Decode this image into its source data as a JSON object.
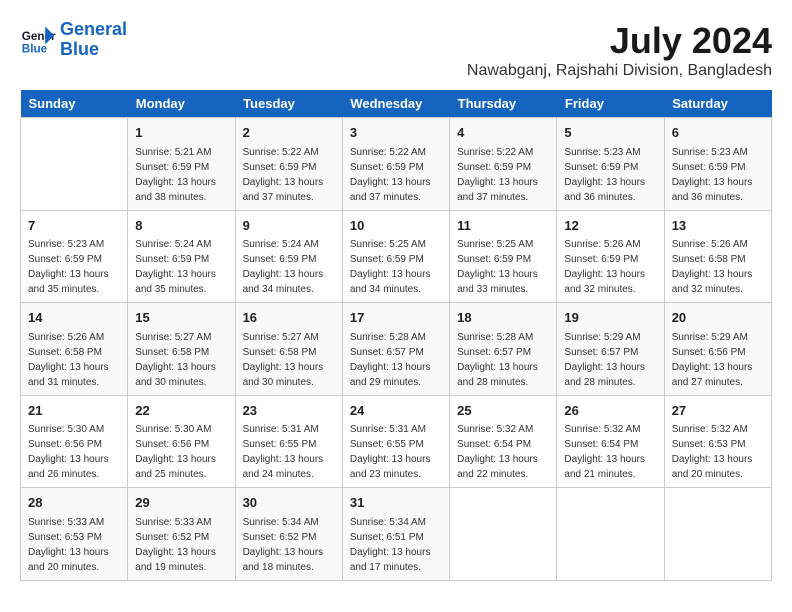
{
  "logo": {
    "line1": "General",
    "line2": "Blue"
  },
  "title": "July 2024",
  "subtitle": "Nawabganj, Rajshahi Division, Bangladesh",
  "days_of_week": [
    "Sunday",
    "Monday",
    "Tuesday",
    "Wednesday",
    "Thursday",
    "Friday",
    "Saturday"
  ],
  "weeks": [
    [
      {
        "day": "",
        "content": ""
      },
      {
        "day": "1",
        "content": "Sunrise: 5:21 AM\nSunset: 6:59 PM\nDaylight: 13 hours\nand 38 minutes."
      },
      {
        "day": "2",
        "content": "Sunrise: 5:22 AM\nSunset: 6:59 PM\nDaylight: 13 hours\nand 37 minutes."
      },
      {
        "day": "3",
        "content": "Sunrise: 5:22 AM\nSunset: 6:59 PM\nDaylight: 13 hours\nand 37 minutes."
      },
      {
        "day": "4",
        "content": "Sunrise: 5:22 AM\nSunset: 6:59 PM\nDaylight: 13 hours\nand 37 minutes."
      },
      {
        "day": "5",
        "content": "Sunrise: 5:23 AM\nSunset: 6:59 PM\nDaylight: 13 hours\nand 36 minutes."
      },
      {
        "day": "6",
        "content": "Sunrise: 5:23 AM\nSunset: 6:59 PM\nDaylight: 13 hours\nand 36 minutes."
      }
    ],
    [
      {
        "day": "7",
        "content": "Sunrise: 5:23 AM\nSunset: 6:59 PM\nDaylight: 13 hours\nand 35 minutes."
      },
      {
        "day": "8",
        "content": "Sunrise: 5:24 AM\nSunset: 6:59 PM\nDaylight: 13 hours\nand 35 minutes."
      },
      {
        "day": "9",
        "content": "Sunrise: 5:24 AM\nSunset: 6:59 PM\nDaylight: 13 hours\nand 34 minutes."
      },
      {
        "day": "10",
        "content": "Sunrise: 5:25 AM\nSunset: 6:59 PM\nDaylight: 13 hours\nand 34 minutes."
      },
      {
        "day": "11",
        "content": "Sunrise: 5:25 AM\nSunset: 6:59 PM\nDaylight: 13 hours\nand 33 minutes."
      },
      {
        "day": "12",
        "content": "Sunrise: 5:26 AM\nSunset: 6:59 PM\nDaylight: 13 hours\nand 32 minutes."
      },
      {
        "day": "13",
        "content": "Sunrise: 5:26 AM\nSunset: 6:58 PM\nDaylight: 13 hours\nand 32 minutes."
      }
    ],
    [
      {
        "day": "14",
        "content": "Sunrise: 5:26 AM\nSunset: 6:58 PM\nDaylight: 13 hours\nand 31 minutes."
      },
      {
        "day": "15",
        "content": "Sunrise: 5:27 AM\nSunset: 6:58 PM\nDaylight: 13 hours\nand 30 minutes."
      },
      {
        "day": "16",
        "content": "Sunrise: 5:27 AM\nSunset: 6:58 PM\nDaylight: 13 hours\nand 30 minutes."
      },
      {
        "day": "17",
        "content": "Sunrise: 5:28 AM\nSunset: 6:57 PM\nDaylight: 13 hours\nand 29 minutes."
      },
      {
        "day": "18",
        "content": "Sunrise: 5:28 AM\nSunset: 6:57 PM\nDaylight: 13 hours\nand 28 minutes."
      },
      {
        "day": "19",
        "content": "Sunrise: 5:29 AM\nSunset: 6:57 PM\nDaylight: 13 hours\nand 28 minutes."
      },
      {
        "day": "20",
        "content": "Sunrise: 5:29 AM\nSunset: 6:56 PM\nDaylight: 13 hours\nand 27 minutes."
      }
    ],
    [
      {
        "day": "21",
        "content": "Sunrise: 5:30 AM\nSunset: 6:56 PM\nDaylight: 13 hours\nand 26 minutes."
      },
      {
        "day": "22",
        "content": "Sunrise: 5:30 AM\nSunset: 6:56 PM\nDaylight: 13 hours\nand 25 minutes."
      },
      {
        "day": "23",
        "content": "Sunrise: 5:31 AM\nSunset: 6:55 PM\nDaylight: 13 hours\nand 24 minutes."
      },
      {
        "day": "24",
        "content": "Sunrise: 5:31 AM\nSunset: 6:55 PM\nDaylight: 13 hours\nand 23 minutes."
      },
      {
        "day": "25",
        "content": "Sunrise: 5:32 AM\nSunset: 6:54 PM\nDaylight: 13 hours\nand 22 minutes."
      },
      {
        "day": "26",
        "content": "Sunrise: 5:32 AM\nSunset: 6:54 PM\nDaylight: 13 hours\nand 21 minutes."
      },
      {
        "day": "27",
        "content": "Sunrise: 5:32 AM\nSunset: 6:53 PM\nDaylight: 13 hours\nand 20 minutes."
      }
    ],
    [
      {
        "day": "28",
        "content": "Sunrise: 5:33 AM\nSunset: 6:53 PM\nDaylight: 13 hours\nand 20 minutes."
      },
      {
        "day": "29",
        "content": "Sunrise: 5:33 AM\nSunset: 6:52 PM\nDaylight: 13 hours\nand 19 minutes."
      },
      {
        "day": "30",
        "content": "Sunrise: 5:34 AM\nSunset: 6:52 PM\nDaylight: 13 hours\nand 18 minutes."
      },
      {
        "day": "31",
        "content": "Sunrise: 5:34 AM\nSunset: 6:51 PM\nDaylight: 13 hours\nand 17 minutes."
      },
      {
        "day": "",
        "content": ""
      },
      {
        "day": "",
        "content": ""
      },
      {
        "day": "",
        "content": ""
      }
    ]
  ]
}
